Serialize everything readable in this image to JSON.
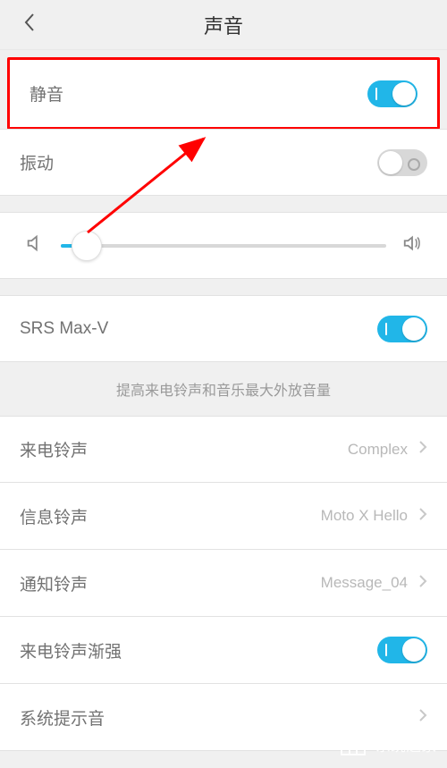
{
  "header": {
    "title": "声音"
  },
  "items": {
    "silent": {
      "label": "静音",
      "on": true
    },
    "vibrate": {
      "label": "振动",
      "on": false
    },
    "srs": {
      "label": "SRS Max-V",
      "on": true
    },
    "srs_hint": "提高来电铃声和音乐最大外放音量",
    "incoming_ringtone": {
      "label": "来电铃声",
      "value": "Complex"
    },
    "msg_ringtone": {
      "label": "信息铃声",
      "value": "Moto X Hello"
    },
    "notif_ringtone": {
      "label": "通知铃声",
      "value": "Message_04"
    },
    "rising_ringtone": {
      "label": "来电铃声渐强",
      "on": true
    },
    "system_sound": {
      "label": "系统提示音"
    }
  },
  "volume": {
    "percent": 8
  },
  "watermark": "系统之家"
}
